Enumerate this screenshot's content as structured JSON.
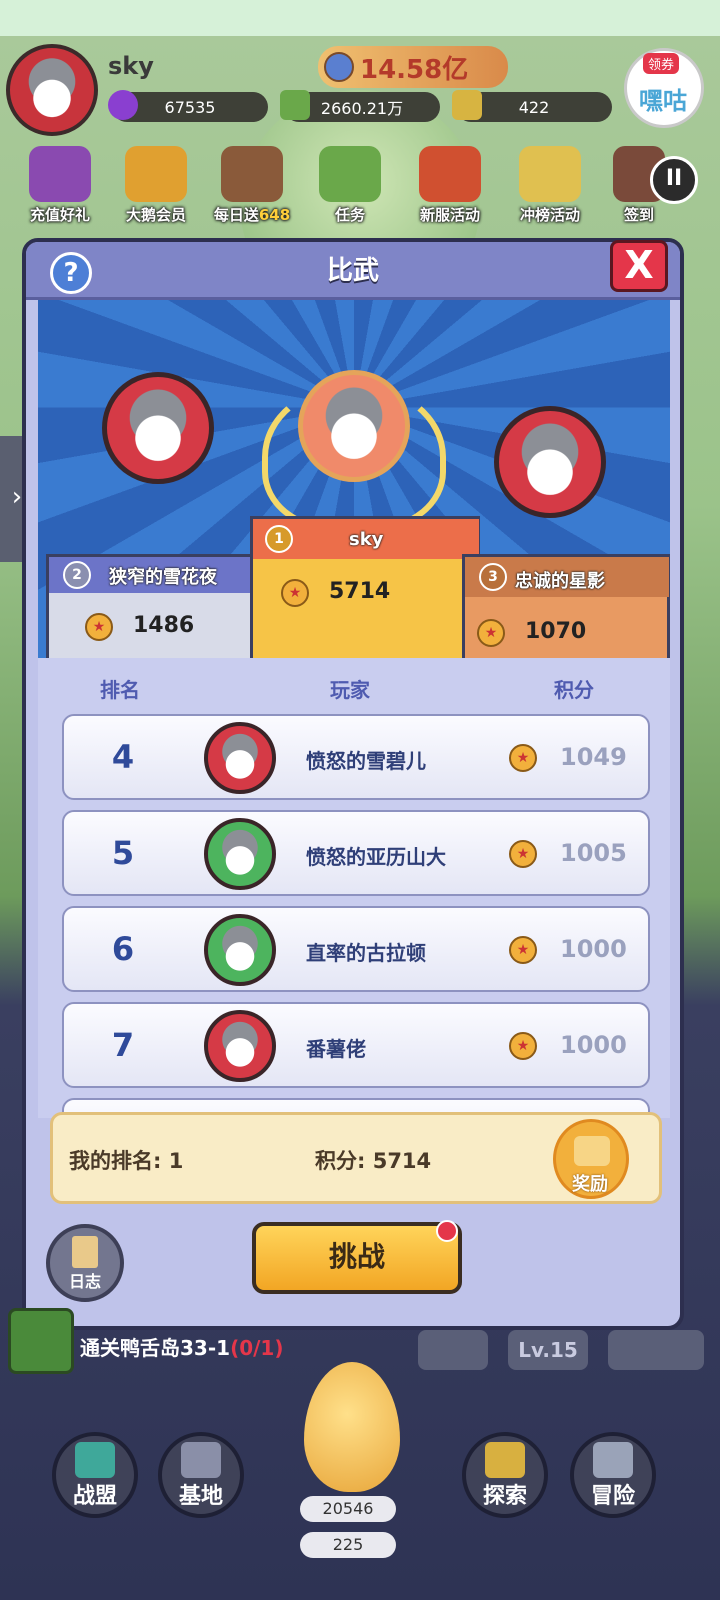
{
  "player": {
    "name": "sky",
    "gold": "14.58亿"
  },
  "resources": {
    "gems": "67535",
    "cash": "2660.21万",
    "tickets": "422"
  },
  "coupon": {
    "tag": "领券",
    "label": "嘿咕"
  },
  "activities": [
    {
      "label": "充值好礼"
    },
    {
      "label": "大鹅会员"
    },
    {
      "label": "每日送",
      "extra": "648"
    },
    {
      "label": "任务"
    },
    {
      "label": "新服活动"
    },
    {
      "label": "冲榜活动"
    },
    {
      "label": "签到"
    }
  ],
  "modal": {
    "title": "比武",
    "help": "?",
    "close": "X"
  },
  "podium": {
    "first": {
      "rank": "1",
      "name": "sky",
      "score": "5714"
    },
    "second": {
      "rank": "2",
      "name": "狭窄的雪花夜",
      "score": "1486"
    },
    "third": {
      "rank": "3",
      "name": "忠诚的星影",
      "score": "1070"
    }
  },
  "list": {
    "headers": {
      "rank": "排名",
      "player": "玩家",
      "score": "积分"
    },
    "rows": [
      {
        "rank": "4",
        "name": "愤怒的雪碧儿",
        "score": "1049",
        "color": "#d53a46"
      },
      {
        "rank": "5",
        "name": "愤怒的亚历山大",
        "score": "1005",
        "color": "#4db45e"
      },
      {
        "rank": "6",
        "name": "直率的古拉顿",
        "score": "1000",
        "color": "#4db45e"
      },
      {
        "rank": "7",
        "name": "番薯佬",
        "score": "1000",
        "color": "#d53a46"
      }
    ]
  },
  "mine": {
    "rank_label": "我的排名: 1",
    "score_label": "积分: 5714",
    "reward": "奖励"
  },
  "buttons": {
    "challenge": "挑战",
    "log": "日志"
  },
  "quest": {
    "text": "通关鸭舌岛33-1",
    "progress": "(0/1)",
    "level": "Lv.15"
  },
  "bottom_nav": [
    {
      "label": "战盟"
    },
    {
      "label": "基地"
    },
    {
      "label": "探索"
    },
    {
      "label": "冒险"
    }
  ],
  "egg": {
    "count1": "20546",
    "count2": "225"
  },
  "colors": {
    "accent": "#e4364a",
    "gold": "#f2b03c",
    "modal_bg": "#bfc3ea"
  }
}
